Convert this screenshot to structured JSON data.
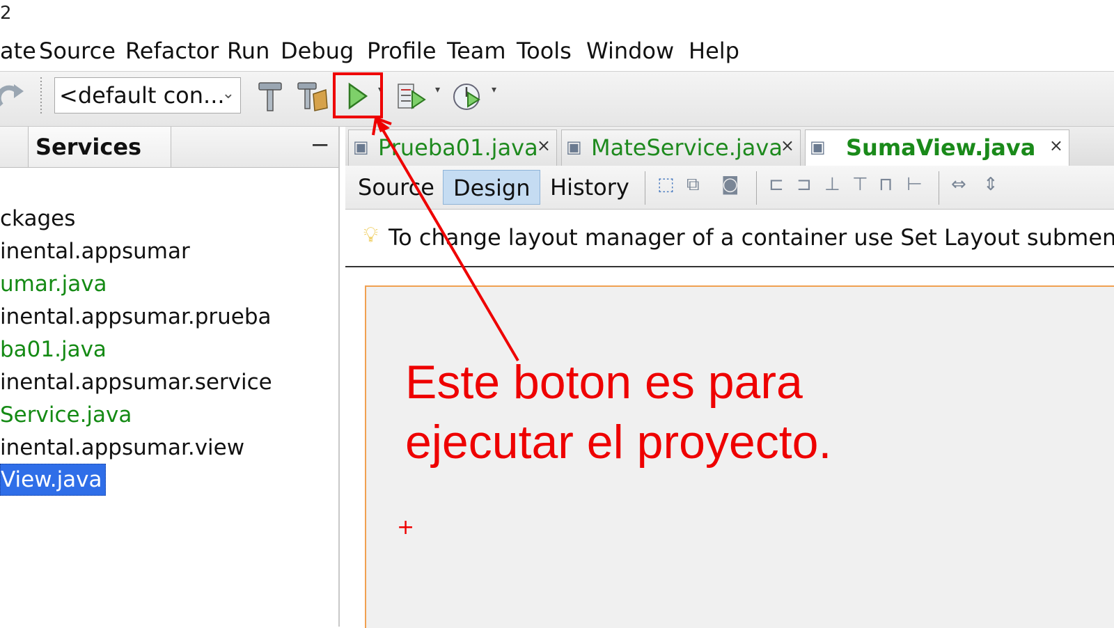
{
  "window": {
    "title_fragment": "2"
  },
  "menubar": {
    "items": [
      "ate",
      "Source",
      "Refactor",
      "Run",
      "Debug",
      "Profile",
      "Team",
      "Tools",
      "Window",
      "Help"
    ]
  },
  "toolbar": {
    "config_value": "<default con...",
    "buttons": [
      "redo-icon",
      "build-icon",
      "clean-build-icon",
      "run-icon",
      "debug-icon",
      "profile-icon"
    ]
  },
  "services": {
    "tab_label": "Services",
    "minimize_label": "−",
    "tree": [
      {
        "label": "ckages",
        "kind": "pkg"
      },
      {
        "label": "inental.appsumar",
        "kind": "pkg"
      },
      {
        "label": "umar.java",
        "kind": "file"
      },
      {
        "label": "inental.appsumar.prueba",
        "kind": "pkg"
      },
      {
        "label": "ba01.java",
        "kind": "file"
      },
      {
        "label": "inental.appsumar.service",
        "kind": "pkg"
      },
      {
        "label": "Service.java",
        "kind": "file"
      },
      {
        "label": "inental.appsumar.view",
        "kind": "pkg"
      },
      {
        "label": "View.java",
        "kind": "selected"
      }
    ]
  },
  "editor": {
    "tabs": [
      {
        "label": "Prueba01.java",
        "close": "×"
      },
      {
        "label": "MateService.java",
        "close": "×"
      },
      {
        "label": "SumaView.java",
        "close": "×"
      }
    ],
    "view_tabs": [
      "Source",
      "Design",
      "History"
    ],
    "hint": "To change layout manager of a container use Set Layout submen"
  },
  "annotation": {
    "line1": "Este boton es para",
    "line2": "ejecutar el proyecto."
  },
  "colors": {
    "annotation": "#ee0000",
    "selection": "#2f6ee8",
    "file_green": "#148a14"
  }
}
